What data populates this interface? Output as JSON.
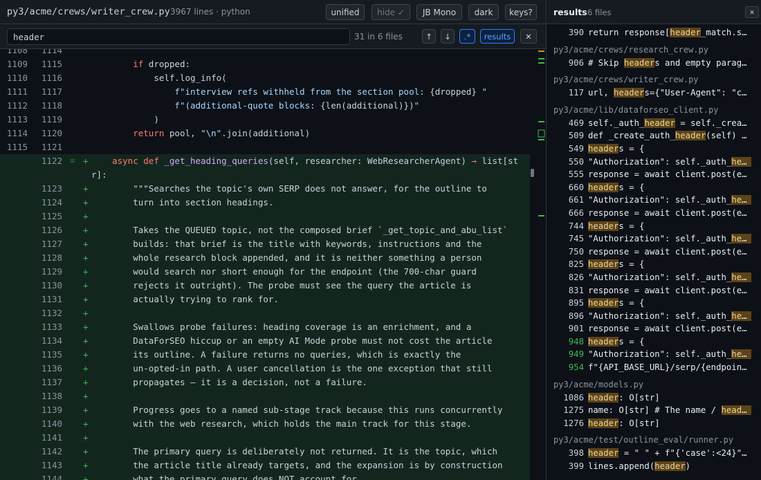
{
  "header": {
    "file_path": "py3/acme/crews/writer_crew.py",
    "file_meta": "3967 lines · python",
    "buttons": {
      "unified": "unified",
      "hide": "hide ✓",
      "font": "JB Mono",
      "theme": "dark",
      "keys": "keys?"
    }
  },
  "search": {
    "value": "header",
    "match_count": "31 in 6 files",
    "prev": "↑",
    "next": "↓",
    "regex": ".*",
    "results": "results",
    "close": "✕"
  },
  "code_lines": [
    {
      "old": "1109",
      "new": "1115",
      "add": false,
      "html": "        <span class=\"kw\">if</span> dropped:"
    },
    {
      "old": "1110",
      "new": "1116",
      "add": false,
      "html": "            self.log_info("
    },
    {
      "old": "1111",
      "new": "1117",
      "add": false,
      "html": "                <span class=\"str\">f\"interview refs withheld from the section pool: </span>{dropped}<span class=\"str\"> \"</span>"
    },
    {
      "old": "1112",
      "new": "1118",
      "add": false,
      "html": "                <span class=\"str\">f\"(additional-quote blocks: </span>{len(additional)}<span class=\"str\">)\"</span>"
    },
    {
      "old": "1113",
      "new": "1119",
      "add": false,
      "html": "            )"
    },
    {
      "old": "1114",
      "new": "1120",
      "add": false,
      "html": "        <span class=\"kw\">return</span> pool, <span class=\"str\">\"\\n\"</span>.join(additional)"
    },
    {
      "old": "1115",
      "new": "1121",
      "add": false,
      "html": ""
    },
    {
      "old": "",
      "new": "1122",
      "add": true,
      "mark": true,
      "wrap": true,
      "html": "    <span class=\"kw\">async def</span> <span class=\"fn\">_get_heading_queries</span>(self, researcher: WebResearcherAgent) <span class=\"kw\">→</span> list[str]:"
    },
    {
      "old": "",
      "new": "1123",
      "add": true,
      "html": "        <span class=\"doc\">\"\"\"Searches the topic's own SERP does not answer, for the outline to</span>"
    },
    {
      "old": "",
      "new": "1124",
      "add": true,
      "html": "        <span class=\"doc\">turn into section headings.</span>"
    },
    {
      "old": "",
      "new": "1125",
      "add": true,
      "html": ""
    },
    {
      "old": "",
      "new": "1126",
      "add": true,
      "html": "        <span class=\"doc\">Takes the QUEUED topic, not the composed brief `_get_topic_and_abu_list`</span>"
    },
    {
      "old": "",
      "new": "1127",
      "add": true,
      "html": "        <span class=\"doc\">builds: that brief is the title with keywords, instructions and the</span>"
    },
    {
      "old": "",
      "new": "1128",
      "add": true,
      "html": "        <span class=\"doc\">whole research block appended, and it is neither something a person</span>"
    },
    {
      "old": "",
      "new": "1129",
      "add": true,
      "html": "        <span class=\"doc\">would search nor short enough for the endpoint (the 700-char guard</span>"
    },
    {
      "old": "",
      "new": "1130",
      "add": true,
      "html": "        <span class=\"doc\">rejects it outright). The probe must see the query the article is</span>"
    },
    {
      "old": "",
      "new": "1131",
      "add": true,
      "html": "        <span class=\"doc\">actually trying to rank for.</span>"
    },
    {
      "old": "",
      "new": "1132",
      "add": true,
      "html": ""
    },
    {
      "old": "",
      "new": "1133",
      "add": true,
      "html": "        <span class=\"doc\">Swallows probe failures: heading coverage is an enrichment, and a</span>"
    },
    {
      "old": "",
      "new": "1134",
      "add": true,
      "html": "        <span class=\"doc\">DataForSEO hiccup or an empty AI Mode probe must not cost the article</span>"
    },
    {
      "old": "",
      "new": "1135",
      "add": true,
      "html": "        <span class=\"doc\">its outline. A failure returns no queries, which is exactly the</span>"
    },
    {
      "old": "",
      "new": "1136",
      "add": true,
      "html": "        <span class=\"doc\">un-opted-in path. A user cancellation is the one exception that still</span>"
    },
    {
      "old": "",
      "new": "1137",
      "add": true,
      "html": "        <span class=\"doc\">propagates — it is a decision, not a failure.</span>"
    },
    {
      "old": "",
      "new": "1138",
      "add": true,
      "html": ""
    },
    {
      "old": "",
      "new": "1139",
      "add": true,
      "html": "        <span class=\"doc\">Progress goes to a named sub-stage track because this runs concurrently</span>"
    },
    {
      "old": "",
      "new": "1140",
      "add": true,
      "html": "        <span class=\"doc\">with the web research, which holds the main track for this stage.</span>"
    },
    {
      "old": "",
      "new": "1141",
      "add": true,
      "html": ""
    },
    {
      "old": "",
      "new": "1142",
      "add": true,
      "html": "        <span class=\"doc\">The primary query is deliberately not returned. It is the topic, which</span>"
    },
    {
      "old": "",
      "new": "1143",
      "add": true,
      "html": "        <span class=\"doc\">the article title already targets, and the expansion is by construction</span>"
    },
    {
      "old": "",
      "new": "1144",
      "add": true,
      "html": "        <span class=\"doc\">what the primary query does NOT account for.</span>"
    }
  ],
  "results": {
    "title": "results",
    "count": "6 files",
    "close": "✕",
    "groups": [
      {
        "file": "",
        "rows": [
          {
            "n": "390",
            "g": false,
            "html": "return response[<span class=\"hl\">header</span>_match.star..."
          }
        ]
      },
      {
        "file": "py3/acme/crews/research_crew.py",
        "rows": [
          {
            "n": "906",
            "g": false,
            "html": "# Skip <span class=\"hl\">header</span>s and empty paragrap..."
          }
        ]
      },
      {
        "file": "py3/acme/crews/writer_crew.py",
        "rows": [
          {
            "n": "117",
            "g": false,
            "html": "url, <span class=\"hl\">header</span>s={\"User-Agent\": \"curr..."
          }
        ]
      },
      {
        "file": "py3/acme/lib/dataforseo_client.py",
        "rows": [
          {
            "n": "469",
            "g": false,
            "html": "self._auth_<span class=\"hl\">header</span> = self._create_..."
          },
          {
            "n": "509",
            "g": false,
            "html": "def _create_auth_<span class=\"hl\">header</span>(self) → ..."
          },
          {
            "n": "549",
            "g": false,
            "html": "<span class=\"hl\">header</span>s = {"
          },
          {
            "n": "550",
            "g": false,
            "html": "\"Authorization\": self._auth_<span class=\"hl\">heade</span>..."
          },
          {
            "n": "555",
            "g": false,
            "html": "response = await client.post(endp..."
          },
          {
            "n": "660",
            "g": false,
            "html": "<span class=\"hl\">header</span>s = {"
          },
          {
            "n": "661",
            "g": false,
            "html": "\"Authorization\": self._auth_<span class=\"hl\">heade</span>..."
          },
          {
            "n": "666",
            "g": false,
            "html": "response = await client.post(endp..."
          },
          {
            "n": "744",
            "g": false,
            "html": "<span class=\"hl\">header</span>s = {"
          },
          {
            "n": "745",
            "g": false,
            "html": "\"Authorization\": self._auth_<span class=\"hl\">heade</span>..."
          },
          {
            "n": "750",
            "g": false,
            "html": "response = await client.post(endp..."
          },
          {
            "n": "825",
            "g": false,
            "html": "<span class=\"hl\">header</span>s = {"
          },
          {
            "n": "826",
            "g": false,
            "html": "\"Authorization\": self._auth_<span class=\"hl\">heade</span>..."
          },
          {
            "n": "831",
            "g": false,
            "html": "response = await client.post(endp..."
          },
          {
            "n": "895",
            "g": false,
            "html": "<span class=\"hl\">header</span>s = {"
          },
          {
            "n": "896",
            "g": false,
            "html": "\"Authorization\": self._auth_<span class=\"hl\">heade</span>..."
          },
          {
            "n": "901",
            "g": false,
            "html": "response = await client.post(endp..."
          },
          {
            "n": "948",
            "g": true,
            "html": "<span class=\"hl\">header</span>s = {"
          },
          {
            "n": "949",
            "g": true,
            "html": "\"Authorization\": self._auth_<span class=\"hl\">heade</span>..."
          },
          {
            "n": "954",
            "g": true,
            "html": "f\"{API_BASE_URL}/serp/{endpoint}\"..."
          }
        ]
      },
      {
        "file": "py3/acme/models.py",
        "rows": [
          {
            "n": "1086",
            "g": false,
            "html": "<span class=\"hl\">header</span>: O[str]"
          },
          {
            "n": "1275",
            "g": false,
            "html": "name: O[str] # The name / <span class=\"hl\">header</span> ..."
          },
          {
            "n": "1276",
            "g": false,
            "html": "<span class=\"hl\">header</span>: O[str]"
          }
        ]
      },
      {
        "file": "py3/acme/test/outline_eval/runner.py",
        "rows": [
          {
            "n": "398",
            "g": false,
            "html": "<span class=\"hl\">header</span> = \" \" + f\"{'case':<24}\" + ..."
          },
          {
            "n": "399",
            "g": false,
            "html": "lines.append(<span class=\"hl\">header</span>)"
          }
        ]
      }
    ]
  }
}
